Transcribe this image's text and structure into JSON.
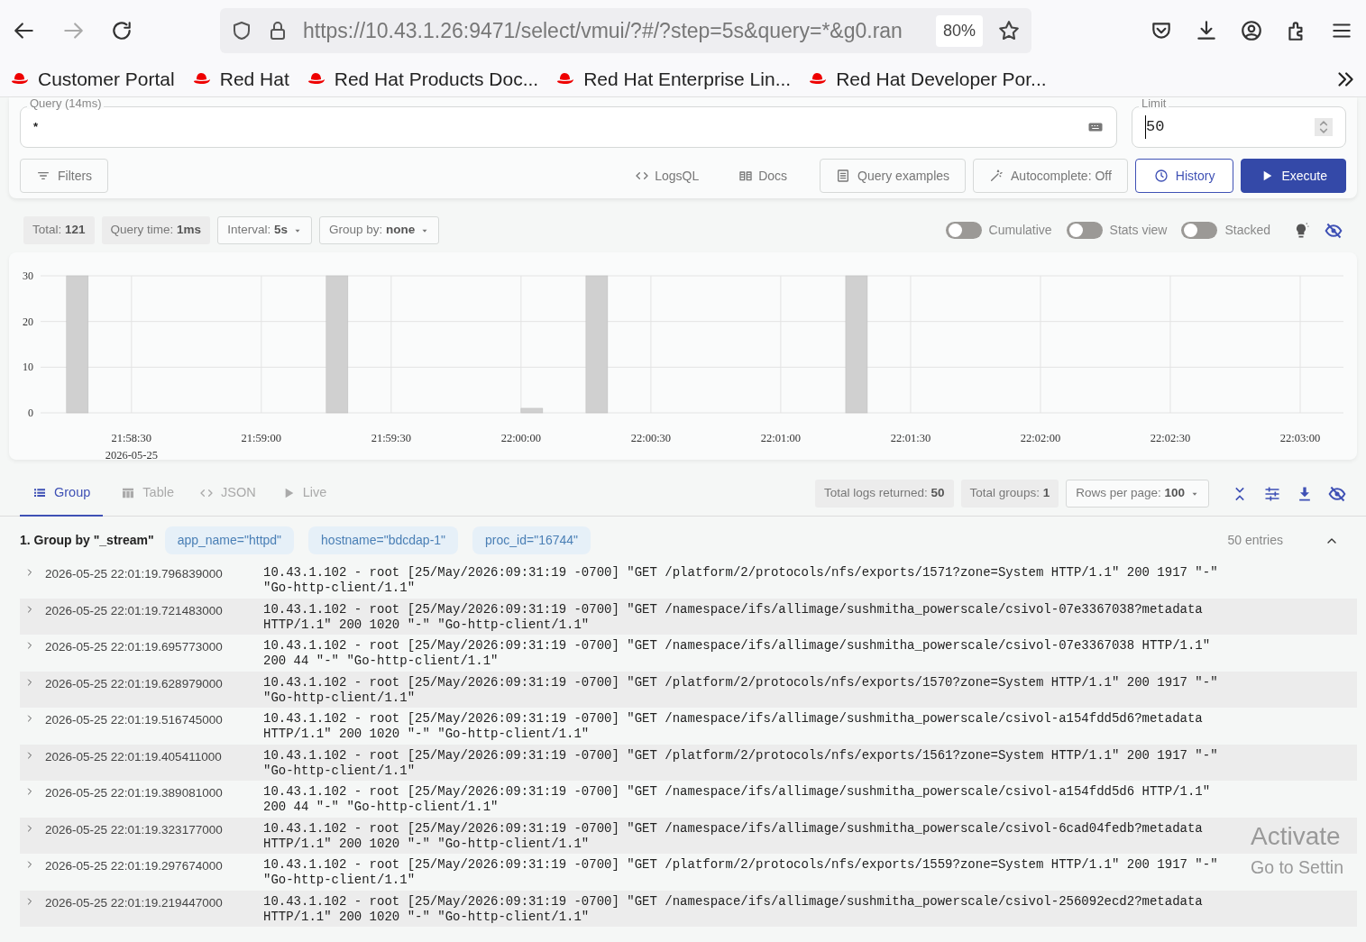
{
  "browser": {
    "url": "https://10.43.1.26:9471/select/vmui/?#/?step=5s&query=*&g0.ran",
    "zoom": "80%"
  },
  "bookmarks": [
    "Customer Portal",
    "Red Hat",
    "Red Hat Products Doc...",
    "Red Hat Enterprise Lin...",
    "Red Hat Developer Por..."
  ],
  "query": {
    "label": "Query (14ms)",
    "value": "*"
  },
  "limit": {
    "label": "Limit",
    "value": "50"
  },
  "toolbar": [
    {
      "label": "Filters",
      "kind": "outline"
    },
    {
      "label": "LogsQL",
      "kind": "link"
    },
    {
      "label": "Docs",
      "kind": "link"
    },
    {
      "label": "Query examples",
      "kind": "outline"
    },
    {
      "label": "Autocomplete: Off",
      "kind": "outline"
    },
    {
      "label": "History",
      "kind": "history"
    },
    {
      "label": "Execute",
      "kind": "primary"
    }
  ],
  "stats": [
    {
      "text": "Total: **121**",
      "kind": "chip"
    },
    {
      "text": "Query time: **1ms**",
      "kind": "chip"
    },
    {
      "text": "Interval: **5s**",
      "kind": "dropdown"
    },
    {
      "text": "Group by: **none**",
      "kind": "dropdown"
    }
  ],
  "toggles": [
    {
      "label": "Cumulative",
      "on": false
    },
    {
      "label": "Stats view",
      "on": false
    },
    {
      "label": "Stacked",
      "on": false
    }
  ],
  "chart": {
    "date_label": "2026-05-25",
    "chart_data": {
      "type": "bar",
      "x": [
        79097.5,
        79157.5,
        79202.5,
        79217.5,
        79277.5
      ],
      "grid": true,
      "series": [
        {
          "color": "#d0d0d0",
          "values": [
            30,
            30,
            1,
            30,
            30
          ]
        }
      ],
      "xlim": [
        79089,
        79390
      ],
      "ylim": [
        0,
        30
      ],
      "xticks": [
        {
          "value": 79110,
          "label": "21:58:30"
        },
        {
          "value": 79140,
          "label": "21:59:00"
        },
        {
          "value": 79170,
          "label": "21:59:30"
        },
        {
          "value": 79200,
          "label": "22:00:00"
        },
        {
          "value": 79230,
          "label": "22:00:30"
        },
        {
          "value": 79260,
          "label": "22:01:00"
        },
        {
          "value": 79290,
          "label": "22:01:30"
        },
        {
          "value": 79320,
          "label": "22:02:00"
        },
        {
          "value": 79350,
          "label": "22:02:30"
        },
        {
          "value": 79380,
          "label": "22:03:00"
        }
      ],
      "yticks": [
        0,
        10,
        20,
        30
      ]
    }
  },
  "tabs": [
    {
      "label": "Group",
      "selected": true
    },
    {
      "label": "Table",
      "selected": false
    },
    {
      "label": "JSON",
      "selected": false
    },
    {
      "label": "Live",
      "selected": false
    }
  ],
  "result_stats": [
    {
      "text": "Total logs returned: **50**",
      "kind": "chip"
    },
    {
      "text": "Total groups: **1**",
      "kind": "chip"
    },
    {
      "text": "Rows per page: **100**",
      "kind": "dropdown"
    }
  ],
  "group": {
    "title": "1. Group by \"_stream\"",
    "tags": [
      "app_name=\"httpd\"",
      "hostname=\"bdcdap-1\"",
      "proc_id=\"16744\""
    ],
    "count": "50 entries",
    "expanded": true
  },
  "rows": [
    {
      "time": "2026-05-25 22:01:19.796839000",
      "message": "10.43.1.102 - root [25/May/2026:09:31:19 -0700] \"GET /platform/2/protocols/nfs/exports/1571?zone=System HTTP/1.1\" 200 1917 \"-\" \"Go-http-client/1.1\"",
      "expanded": false
    },
    {
      "time": "2026-05-25 22:01:19.721483000",
      "message": "10.43.1.102 - root [25/May/2026:09:31:19 -0700] \"GET /namespace/ifs/allimage/sushmitha_powerscale/csivol-07e3367038?metadata HTTP/1.1\" 200 1020 \"-\" \"Go-http-client/1.1\"",
      "expanded": false
    },
    {
      "time": "2026-05-25 22:01:19.695773000",
      "message": "10.43.1.102 - root [25/May/2026:09:31:19 -0700] \"GET /namespace/ifs/allimage/sushmitha_powerscale/csivol-07e3367038 HTTP/1.1\" 200 44 \"-\" \"Go-http-client/1.1\"",
      "expanded": false
    },
    {
      "time": "2026-05-25 22:01:19.628979000",
      "message": "10.43.1.102 - root [25/May/2026:09:31:19 -0700] \"GET /platform/2/protocols/nfs/exports/1570?zone=System HTTP/1.1\" 200 1917 \"-\" \"Go-http-client/1.1\"",
      "expanded": false
    },
    {
      "time": "2026-05-25 22:01:19.516745000",
      "message": "10.43.1.102 - root [25/May/2026:09:31:19 -0700] \"GET /namespace/ifs/allimage/sushmitha_powerscale/csivol-a154fdd5d6?metadata HTTP/1.1\" 200 1020 \"-\" \"Go-http-client/1.1\"",
      "expanded": false
    },
    {
      "time": "2026-05-25 22:01:19.405411000",
      "message": "10.43.1.102 - root [25/May/2026:09:31:19 -0700] \"GET /platform/2/protocols/nfs/exports/1561?zone=System HTTP/1.1\" 200 1917 \"-\" \"Go-http-client/1.1\"",
      "expanded": false
    },
    {
      "time": "2026-05-25 22:01:19.389081000",
      "message": "10.43.1.102 - root [25/May/2026:09:31:19 -0700] \"GET /namespace/ifs/allimage/sushmitha_powerscale/csivol-a154fdd5d6 HTTP/1.1\" 200 44 \"-\" \"Go-http-client/1.1\"",
      "expanded": false
    },
    {
      "time": "2026-05-25 22:01:19.323177000",
      "message": "10.43.1.102 - root [25/May/2026:09:31:19 -0700] \"GET /namespace/ifs/allimage/sushmitha_powerscale/csivol-6cad04fedb?metadata HTTP/1.1\" 200 1020 \"-\" \"Go-http-client/1.1\"",
      "expanded": false
    },
    {
      "time": "2026-05-25 22:01:19.297674000",
      "message": "10.43.1.102 - root [25/May/2026:09:31:19 -0700] \"GET /platform/2/protocols/nfs/exports/1559?zone=System HTTP/1.1\" 200 1917 \"-\" \"Go-http-client/1.1\"",
      "expanded": false
    },
    {
      "time": "2026-05-25 22:01:19.219447000",
      "message": "10.43.1.102 - root [25/May/2026:09:31:19 -0700] \"GET /namespace/ifs/allimage/sushmitha_powerscale/csivol-256092ecd2?metadata HTTP/1.1\" 200 1020 \"-\" \"Go-http-client/1.1\"",
      "expanded": false
    }
  ],
  "activation_notice": {
    "title": "Activate",
    "subtitle": "Go to Settin"
  }
}
